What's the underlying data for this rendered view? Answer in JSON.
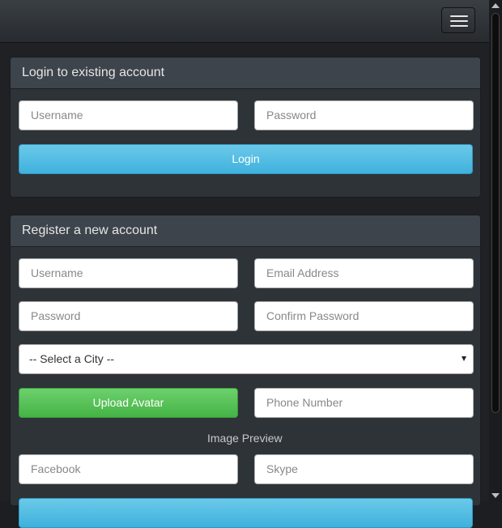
{
  "navbar": {
    "toggle_icon": "hamburger-icon"
  },
  "login": {
    "title": "Login to existing account",
    "username_placeholder": "Username",
    "password_placeholder": "Password",
    "login_label": "Login"
  },
  "register": {
    "title": "Register a new account",
    "username_placeholder": "Username",
    "email_placeholder": "Email Address",
    "password_placeholder": "Password",
    "confirm_placeholder": "Confirm Password",
    "city_selected": "-- Select a City --",
    "upload_label": "Upload Avatar",
    "phone_placeholder": "Phone Number",
    "preview_label": "Image Preview",
    "facebook_placeholder": "Facebook",
    "skype_placeholder": "Skype"
  },
  "colors": {
    "accent_info": "#5bc0de",
    "accent_success": "#62c462",
    "panel_bg": "#2e3338",
    "panel_head_bg": "#3e444c"
  }
}
